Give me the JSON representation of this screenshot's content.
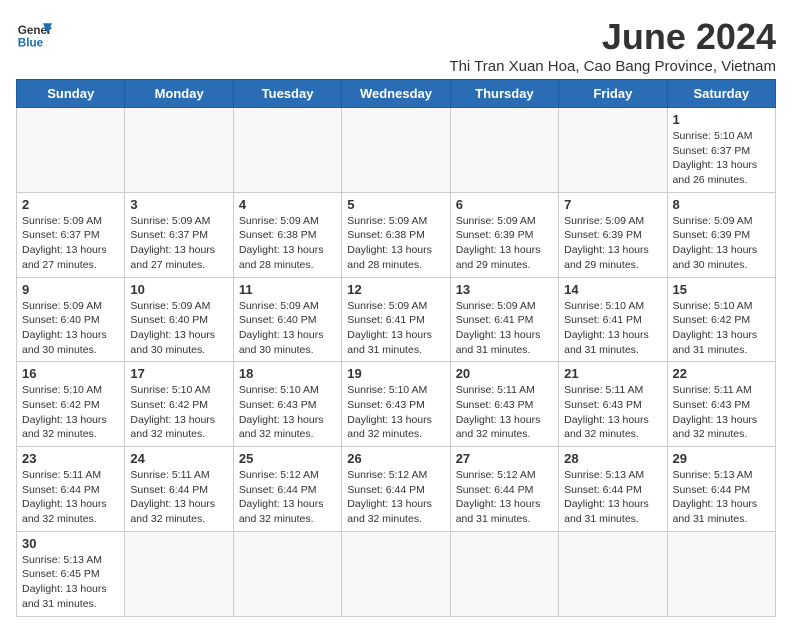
{
  "header": {
    "logo_general": "General",
    "logo_blue": "Blue",
    "month_title": "June 2024",
    "subtitle": "Thi Tran Xuan Hoa, Cao Bang Province, Vietnam"
  },
  "days_of_week": [
    "Sunday",
    "Monday",
    "Tuesday",
    "Wednesday",
    "Thursday",
    "Friday",
    "Saturday"
  ],
  "weeks": [
    [
      {
        "day": "",
        "info": ""
      },
      {
        "day": "",
        "info": ""
      },
      {
        "day": "",
        "info": ""
      },
      {
        "day": "",
        "info": ""
      },
      {
        "day": "",
        "info": ""
      },
      {
        "day": "",
        "info": ""
      },
      {
        "day": "1",
        "info": "Sunrise: 5:10 AM\nSunset: 6:37 PM\nDaylight: 13 hours and 26 minutes."
      }
    ],
    [
      {
        "day": "2",
        "info": "Sunrise: 5:09 AM\nSunset: 6:37 PM\nDaylight: 13 hours and 27 minutes."
      },
      {
        "day": "3",
        "info": "Sunrise: 5:09 AM\nSunset: 6:37 PM\nDaylight: 13 hours and 27 minutes."
      },
      {
        "day": "4",
        "info": "Sunrise: 5:09 AM\nSunset: 6:38 PM\nDaylight: 13 hours and 28 minutes."
      },
      {
        "day": "5",
        "info": "Sunrise: 5:09 AM\nSunset: 6:38 PM\nDaylight: 13 hours and 28 minutes."
      },
      {
        "day": "6",
        "info": "Sunrise: 5:09 AM\nSunset: 6:39 PM\nDaylight: 13 hours and 29 minutes."
      },
      {
        "day": "7",
        "info": "Sunrise: 5:09 AM\nSunset: 6:39 PM\nDaylight: 13 hours and 29 minutes."
      },
      {
        "day": "8",
        "info": "Sunrise: 5:09 AM\nSunset: 6:39 PM\nDaylight: 13 hours and 30 minutes."
      }
    ],
    [
      {
        "day": "9",
        "info": "Sunrise: 5:09 AM\nSunset: 6:40 PM\nDaylight: 13 hours and 30 minutes."
      },
      {
        "day": "10",
        "info": "Sunrise: 5:09 AM\nSunset: 6:40 PM\nDaylight: 13 hours and 30 minutes."
      },
      {
        "day": "11",
        "info": "Sunrise: 5:09 AM\nSunset: 6:40 PM\nDaylight: 13 hours and 30 minutes."
      },
      {
        "day": "12",
        "info": "Sunrise: 5:09 AM\nSunset: 6:41 PM\nDaylight: 13 hours and 31 minutes."
      },
      {
        "day": "13",
        "info": "Sunrise: 5:09 AM\nSunset: 6:41 PM\nDaylight: 13 hours and 31 minutes."
      },
      {
        "day": "14",
        "info": "Sunrise: 5:10 AM\nSunset: 6:41 PM\nDaylight: 13 hours and 31 minutes."
      },
      {
        "day": "15",
        "info": "Sunrise: 5:10 AM\nSunset: 6:42 PM\nDaylight: 13 hours and 31 minutes."
      }
    ],
    [
      {
        "day": "16",
        "info": "Sunrise: 5:10 AM\nSunset: 6:42 PM\nDaylight: 13 hours and 32 minutes."
      },
      {
        "day": "17",
        "info": "Sunrise: 5:10 AM\nSunset: 6:42 PM\nDaylight: 13 hours and 32 minutes."
      },
      {
        "day": "18",
        "info": "Sunrise: 5:10 AM\nSunset: 6:43 PM\nDaylight: 13 hours and 32 minutes."
      },
      {
        "day": "19",
        "info": "Sunrise: 5:10 AM\nSunset: 6:43 PM\nDaylight: 13 hours and 32 minutes."
      },
      {
        "day": "20",
        "info": "Sunrise: 5:11 AM\nSunset: 6:43 PM\nDaylight: 13 hours and 32 minutes."
      },
      {
        "day": "21",
        "info": "Sunrise: 5:11 AM\nSunset: 6:43 PM\nDaylight: 13 hours and 32 minutes."
      },
      {
        "day": "22",
        "info": "Sunrise: 5:11 AM\nSunset: 6:43 PM\nDaylight: 13 hours and 32 minutes."
      }
    ],
    [
      {
        "day": "23",
        "info": "Sunrise: 5:11 AM\nSunset: 6:44 PM\nDaylight: 13 hours and 32 minutes."
      },
      {
        "day": "24",
        "info": "Sunrise: 5:11 AM\nSunset: 6:44 PM\nDaylight: 13 hours and 32 minutes."
      },
      {
        "day": "25",
        "info": "Sunrise: 5:12 AM\nSunset: 6:44 PM\nDaylight: 13 hours and 32 minutes."
      },
      {
        "day": "26",
        "info": "Sunrise: 5:12 AM\nSunset: 6:44 PM\nDaylight: 13 hours and 32 minutes."
      },
      {
        "day": "27",
        "info": "Sunrise: 5:12 AM\nSunset: 6:44 PM\nDaylight: 13 hours and 31 minutes."
      },
      {
        "day": "28",
        "info": "Sunrise: 5:13 AM\nSunset: 6:44 PM\nDaylight: 13 hours and 31 minutes."
      },
      {
        "day": "29",
        "info": "Sunrise: 5:13 AM\nSunset: 6:44 PM\nDaylight: 13 hours and 31 minutes."
      }
    ],
    [
      {
        "day": "30",
        "info": "Sunrise: 5:13 AM\nSunset: 6:45 PM\nDaylight: 13 hours and 31 minutes."
      },
      {
        "day": "",
        "info": ""
      },
      {
        "day": "",
        "info": ""
      },
      {
        "day": "",
        "info": ""
      },
      {
        "day": "",
        "info": ""
      },
      {
        "day": "",
        "info": ""
      },
      {
        "day": "",
        "info": ""
      }
    ]
  ]
}
